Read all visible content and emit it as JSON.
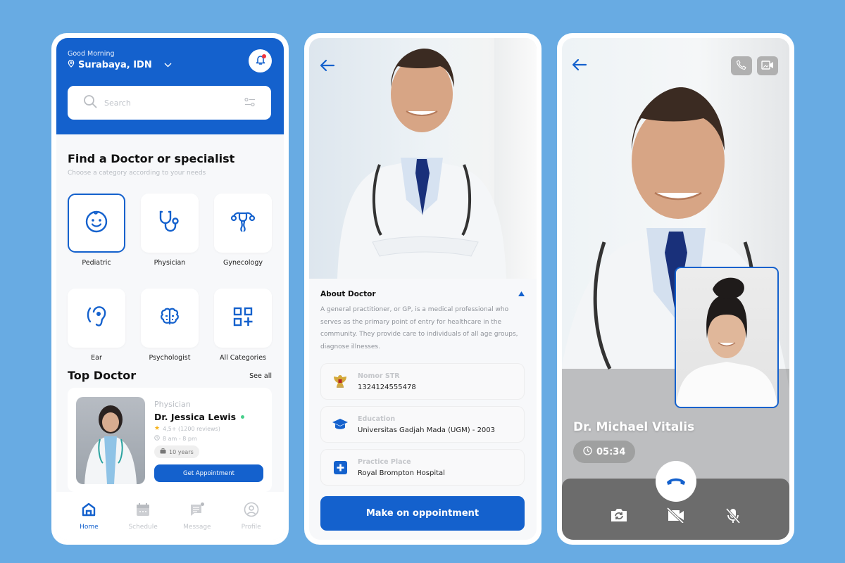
{
  "colors": {
    "brand": "#1461cd",
    "background": "#68abe3",
    "online": "#46cf8a",
    "notification_dot": "#f0353d",
    "star": "#f6b21b"
  },
  "home": {
    "greeting": "Good Morning",
    "location": "Surabaya, IDN",
    "search": {
      "placeholder": "Search"
    },
    "section_title": "Find a Doctor or specialist",
    "section_subtitle": "Choose a category according to your needs",
    "categories": [
      {
        "label": "Pediatric",
        "icon": "baby-face-icon",
        "selected": true
      },
      {
        "label": "Physician",
        "icon": "stethoscope-icon",
        "selected": false
      },
      {
        "label": "Gynecology",
        "icon": "uterus-icon",
        "selected": false
      },
      {
        "label": "Ear",
        "icon": "ear-icon",
        "selected": false
      },
      {
        "label": "Psychologist",
        "icon": "brain-icon",
        "selected": false
      },
      {
        "label": "All Categories",
        "icon": "grid-plus-icon",
        "selected": false
      }
    ],
    "top_doctor_title": "Top Doctor",
    "see_all": "See all",
    "doctor": {
      "specialty": "Physician",
      "name": "Dr. Jessica Lewis",
      "rating": "4,5+ (1200 reviews)",
      "hours": "8 am - 8 pm",
      "experience": "10 years",
      "button": "Get Appointment"
    },
    "nav": [
      {
        "label": "Home",
        "icon": "home-icon",
        "active": true
      },
      {
        "label": "Schedule",
        "icon": "calendar-icon",
        "active": false
      },
      {
        "label": "Message",
        "icon": "message-icon",
        "active": false
      },
      {
        "label": "Profile",
        "icon": "profile-icon",
        "active": false
      }
    ]
  },
  "detail": {
    "about_title": "About Doctor",
    "about_text": "A general practitioner, or GP, is a medical professional who serves as the primary point of entry for healthcare in the community. They provide care to individuals of all age groups, diagnose illnesses.",
    "info": [
      {
        "label": "Nomor STR",
        "value": "1324124555478",
        "icon": "garuda-emblem-icon"
      },
      {
        "label": "Education",
        "value": "Universitas Gadjah Mada (UGM) - 2003",
        "icon": "graduation-cap-icon"
      },
      {
        "label": "Practice Place",
        "value": "Royal Brompton Hospital",
        "icon": "hospital-cross-icon"
      }
    ],
    "button": "Make on oppointment"
  },
  "call": {
    "caller_name": "Dr. Michael Vitalis",
    "duration": "05:34"
  }
}
